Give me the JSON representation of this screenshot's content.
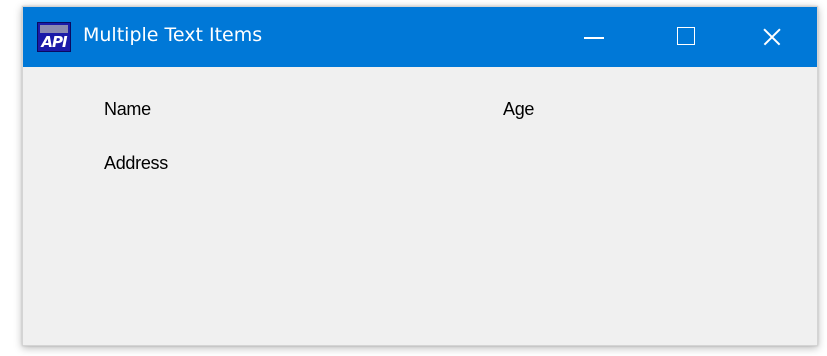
{
  "window": {
    "title": "Multiple Text Items",
    "icon": "api-app-icon",
    "icon_text": "API",
    "accent_color": "#0078d7",
    "controls": {
      "minimize": "minimize-icon",
      "maximize": "maximize-icon",
      "close": "close-icon"
    }
  },
  "content": {
    "labels": {
      "name": "Name",
      "age": "Age",
      "address": "Address"
    }
  }
}
